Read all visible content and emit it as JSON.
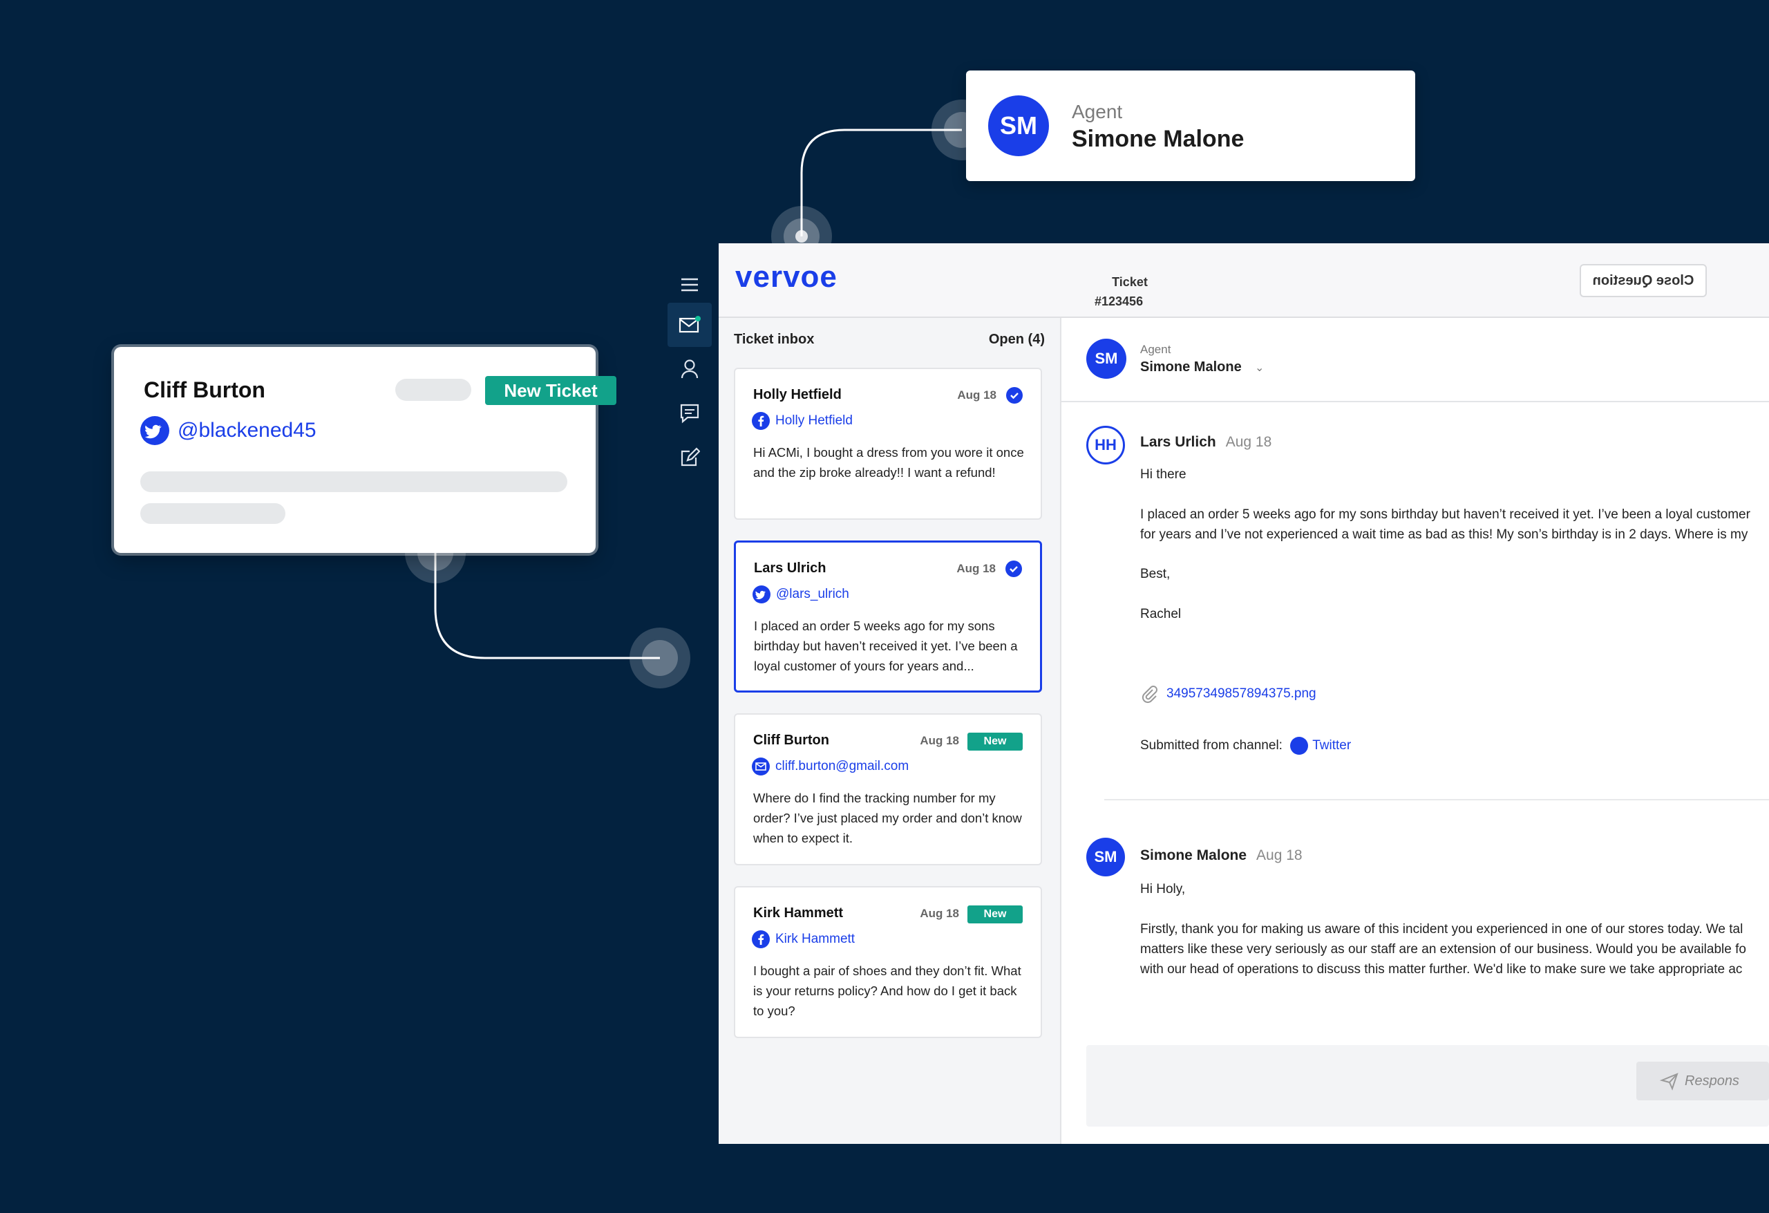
{
  "agent_card": {
    "initials": "SM",
    "role": "Agent",
    "name": "Simone Malone"
  },
  "new_customer_card": {
    "name": "Cliff Burton",
    "handle": "@blackened45",
    "tag": "New Ticket"
  },
  "app": {
    "logo": "vervoe",
    "ticket_label": "Ticket",
    "ticket_number": "#123456",
    "close_button": "Close Question"
  },
  "inbox": {
    "title": "Ticket inbox",
    "open_count": "Open (4)",
    "tickets": [
      {
        "name": "Holly Hetfield",
        "date": "Aug 18",
        "status": "done",
        "channel_icon": "facebook-icon",
        "channel_name": "Holly Hetfield",
        "message": "Hi ACMi, I bought a dress from you wore it once and the zip broke already!! I want a refund!"
      },
      {
        "name": "Lars Ulrich",
        "date": "Aug 18",
        "status": "done",
        "channel_icon": "twitter-icon",
        "channel_name": "@lars_ulrich",
        "message": "I placed an order 5 weeks ago for my sons birthday but haven’t received it yet. I’ve been a loyal customer of yours for years and..."
      },
      {
        "name": "Cliff Burton",
        "date": "Aug 18",
        "status": "New",
        "channel_icon": "mail-icon",
        "channel_name": "cliff.burton@gmail.com",
        "message": "Where do I find the tracking number for my order? I’ve just placed my order and don’t know when to expect it."
      },
      {
        "name": "Kirk Hammett",
        "date": "Aug 18",
        "status": "New",
        "channel_icon": "facebook-icon",
        "channel_name": "Kirk Hammett",
        "message": "I bought a pair of shoes and they don’t fit. What is your returns policy? And how do I get it back to you?"
      }
    ]
  },
  "conversation": {
    "agent_role": "Agent",
    "agent_name": "Simone Malone",
    "agent_initials": "SM",
    "customer_message": {
      "initials": "HH",
      "from": "Lars Urlich",
      "date": "Aug 18",
      "lines": [
        "Hi there",
        "I placed an order 5 weeks ago for my sons birthday but haven’t received it yet. I’ve been a loyal customer",
        "for years and I’ve not experienced a wait time as bad as this! My son’s birthday is in 2 days. Where is my",
        "Best,",
        "Rachel"
      ],
      "attachment": "34957349857894375.png",
      "channel_prefix": "Submitted from channel:",
      "channel": "Twitter"
    },
    "agent_reply": {
      "initials": "SM",
      "from": "Simone Malone",
      "date": "Aug 18",
      "lines": [
        "Hi Holy,",
        "Firstly, thank you for making us aware of this incident you experienced in one of our stores today. We tal",
        "matters like these very seriously as our staff are an extension of our business. Would you be available fo",
        "with our head of operations to discuss this matter further. We'd like to make sure we take appropriate ac"
      ]
    },
    "respond_button": "Respons"
  },
  "colors": {
    "background": "#03223f",
    "accent": "#1a3ee8",
    "new_tag": "#12a28a"
  }
}
